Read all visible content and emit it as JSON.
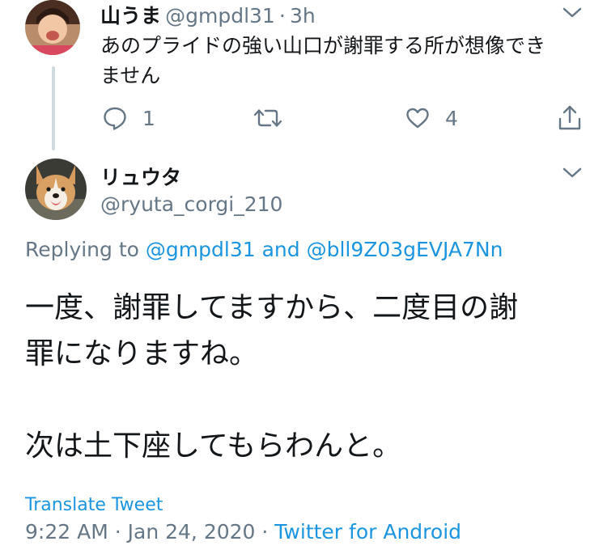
{
  "parent_tweet": {
    "display_name": "山うま",
    "handle": "@gmpdl31",
    "separator": "·",
    "time_ago": "3h",
    "text": "あのプライドの強い山口が謝罪する所が想像できませんせん",
    "text_lines": [
      "あのプライドの強い山口が謝罪する所が想像でき",
      "ません"
    ],
    "actions": {
      "reply_icon": "reply-icon",
      "reply_count": "1",
      "retweet_icon": "retweet-icon",
      "like_icon": "heart-icon",
      "like_count": "4",
      "share_icon": "share-icon"
    }
  },
  "main_tweet": {
    "display_name": "リュウタ",
    "handle": "@ryuta_corgi_210",
    "replying_prefix": "Replying to",
    "replying_user1": "@gmpdl31",
    "replying_and": "and",
    "replying_user2": "@bll9Z03gEVJA7Nn",
    "text": "一度、謝罪してますから、二度目の謝\n罪になりますね。\n\n次は土下座してもらわんと。",
    "translate_label": "Translate Tweet",
    "time": "9:22 AM",
    "date_separator": "·",
    "date": "Jan 24, 2020",
    "source_separator": "·",
    "source": "Twitter for Android"
  },
  "colors": {
    "link": "#1b95e0",
    "secondary_text": "#657786",
    "primary_text": "#14171a",
    "thread_line": "#cfd9de"
  }
}
